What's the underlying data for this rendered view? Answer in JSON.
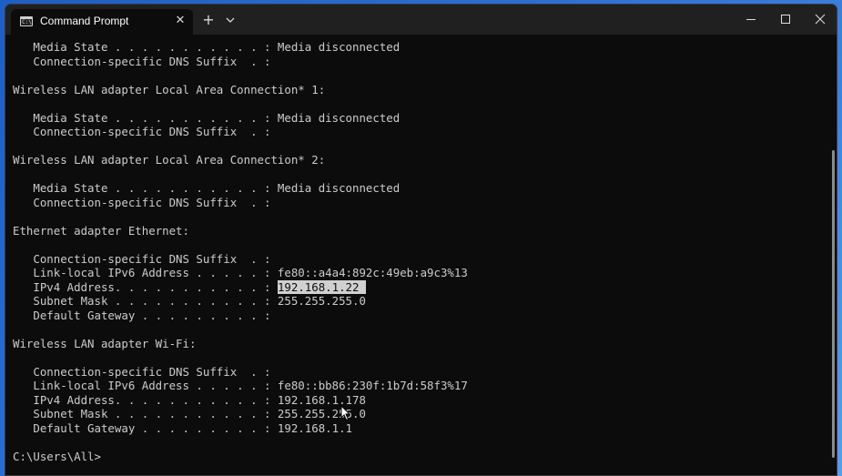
{
  "window": {
    "tab_title": "Command Prompt",
    "tab_icon_text": "C:\\",
    "tab_close_glyph": "✕",
    "new_tab_glyph": "+"
  },
  "console": {
    "lines": [
      "   Media State . . . . . . . . . . . : Media disconnected",
      "   Connection-specific DNS Suffix  . :",
      "",
      "Wireless LAN adapter Local Area Connection* 1:",
      "",
      "   Media State . . . . . . . . . . . : Media disconnected",
      "   Connection-specific DNS Suffix  . :",
      "",
      "Wireless LAN adapter Local Area Connection* 2:",
      "",
      "   Media State . . . . . . . . . . . : Media disconnected",
      "   Connection-specific DNS Suffix  . :",
      "",
      "Ethernet adapter Ethernet:",
      "",
      "   Connection-specific DNS Suffix  . :",
      "   Link-local IPv6 Address . . . . . : fe80::a4a4:892c:49eb:a9c3%13",
      "   IPv4 Address. . . . . . . . . . . : ",
      "   Subnet Mask . . . . . . . . . . . : 255.255.255.0",
      "   Default Gateway . . . . . . . . . :",
      "",
      "Wireless LAN adapter Wi-Fi:",
      "",
      "   Connection-specific DNS Suffix  . :",
      "   Link-local IPv6 Address . . . . . : fe80::bb86:230f:1b7d:58f3%17",
      "   IPv4 Address. . . . . . . . . . . : 192.168.1.178",
      "   Subnet Mask . . . . . . . . . . . : 255.255.255.0",
      "   Default Gateway . . . . . . . . . : 192.168.1.1",
      "",
      "C:\\Users\\All>"
    ],
    "highlighted_selection": "192.168.1.22 "
  },
  "icons": {
    "terminal": "terminal-icon",
    "close": "close-icon",
    "add": "plus-icon",
    "dropdown": "chevron-down-icon",
    "minimize": "minimize-icon",
    "maximize": "maximize-icon",
    "window_close": "window-close-icon",
    "cursor": "mouse-cursor-icon"
  },
  "colors": {
    "console_bg": "#0c0c0c",
    "console_text": "#cccccc",
    "titlebar_bg": "#202020",
    "selection_bg": "#d0d0d0"
  }
}
